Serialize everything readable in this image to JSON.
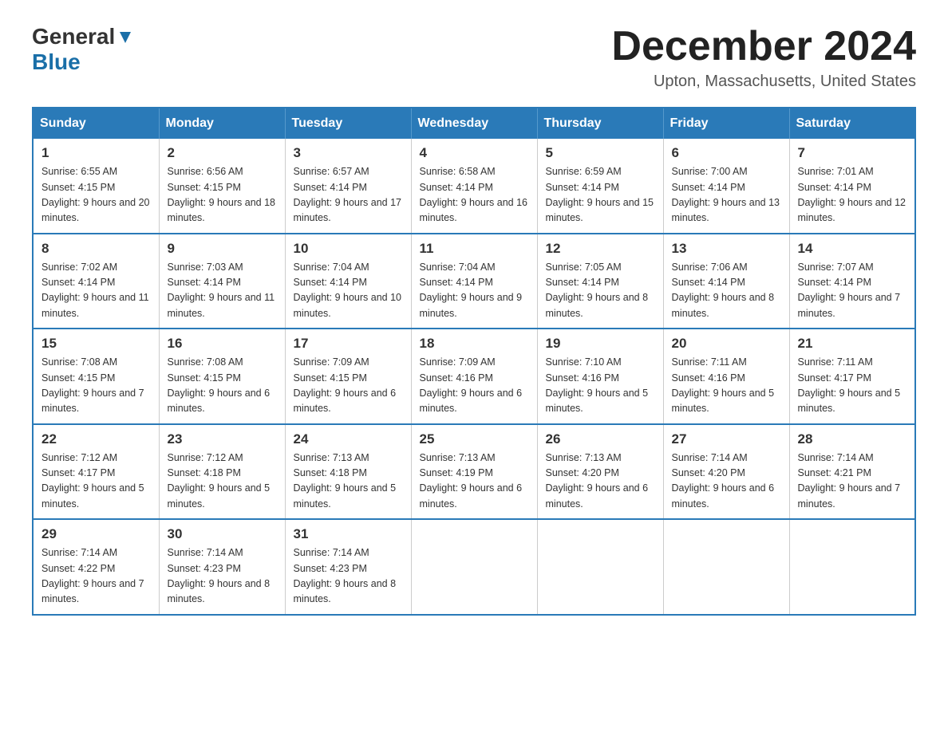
{
  "header": {
    "logo_general": "General",
    "logo_blue": "Blue",
    "month_title": "December 2024",
    "location": "Upton, Massachusetts, United States"
  },
  "days_of_week": [
    "Sunday",
    "Monday",
    "Tuesday",
    "Wednesday",
    "Thursday",
    "Friday",
    "Saturday"
  ],
  "weeks": [
    [
      {
        "day": "1",
        "sunrise": "Sunrise: 6:55 AM",
        "sunset": "Sunset: 4:15 PM",
        "daylight": "Daylight: 9 hours and 20 minutes."
      },
      {
        "day": "2",
        "sunrise": "Sunrise: 6:56 AM",
        "sunset": "Sunset: 4:15 PM",
        "daylight": "Daylight: 9 hours and 18 minutes."
      },
      {
        "day": "3",
        "sunrise": "Sunrise: 6:57 AM",
        "sunset": "Sunset: 4:14 PM",
        "daylight": "Daylight: 9 hours and 17 minutes."
      },
      {
        "day": "4",
        "sunrise": "Sunrise: 6:58 AM",
        "sunset": "Sunset: 4:14 PM",
        "daylight": "Daylight: 9 hours and 16 minutes."
      },
      {
        "day": "5",
        "sunrise": "Sunrise: 6:59 AM",
        "sunset": "Sunset: 4:14 PM",
        "daylight": "Daylight: 9 hours and 15 minutes."
      },
      {
        "day": "6",
        "sunrise": "Sunrise: 7:00 AM",
        "sunset": "Sunset: 4:14 PM",
        "daylight": "Daylight: 9 hours and 13 minutes."
      },
      {
        "day": "7",
        "sunrise": "Sunrise: 7:01 AM",
        "sunset": "Sunset: 4:14 PM",
        "daylight": "Daylight: 9 hours and 12 minutes."
      }
    ],
    [
      {
        "day": "8",
        "sunrise": "Sunrise: 7:02 AM",
        "sunset": "Sunset: 4:14 PM",
        "daylight": "Daylight: 9 hours and 11 minutes."
      },
      {
        "day": "9",
        "sunrise": "Sunrise: 7:03 AM",
        "sunset": "Sunset: 4:14 PM",
        "daylight": "Daylight: 9 hours and 11 minutes."
      },
      {
        "day": "10",
        "sunrise": "Sunrise: 7:04 AM",
        "sunset": "Sunset: 4:14 PM",
        "daylight": "Daylight: 9 hours and 10 minutes."
      },
      {
        "day": "11",
        "sunrise": "Sunrise: 7:04 AM",
        "sunset": "Sunset: 4:14 PM",
        "daylight": "Daylight: 9 hours and 9 minutes."
      },
      {
        "day": "12",
        "sunrise": "Sunrise: 7:05 AM",
        "sunset": "Sunset: 4:14 PM",
        "daylight": "Daylight: 9 hours and 8 minutes."
      },
      {
        "day": "13",
        "sunrise": "Sunrise: 7:06 AM",
        "sunset": "Sunset: 4:14 PM",
        "daylight": "Daylight: 9 hours and 8 minutes."
      },
      {
        "day": "14",
        "sunrise": "Sunrise: 7:07 AM",
        "sunset": "Sunset: 4:14 PM",
        "daylight": "Daylight: 9 hours and 7 minutes."
      }
    ],
    [
      {
        "day": "15",
        "sunrise": "Sunrise: 7:08 AM",
        "sunset": "Sunset: 4:15 PM",
        "daylight": "Daylight: 9 hours and 7 minutes."
      },
      {
        "day": "16",
        "sunrise": "Sunrise: 7:08 AM",
        "sunset": "Sunset: 4:15 PM",
        "daylight": "Daylight: 9 hours and 6 minutes."
      },
      {
        "day": "17",
        "sunrise": "Sunrise: 7:09 AM",
        "sunset": "Sunset: 4:15 PM",
        "daylight": "Daylight: 9 hours and 6 minutes."
      },
      {
        "day": "18",
        "sunrise": "Sunrise: 7:09 AM",
        "sunset": "Sunset: 4:16 PM",
        "daylight": "Daylight: 9 hours and 6 minutes."
      },
      {
        "day": "19",
        "sunrise": "Sunrise: 7:10 AM",
        "sunset": "Sunset: 4:16 PM",
        "daylight": "Daylight: 9 hours and 5 minutes."
      },
      {
        "day": "20",
        "sunrise": "Sunrise: 7:11 AM",
        "sunset": "Sunset: 4:16 PM",
        "daylight": "Daylight: 9 hours and 5 minutes."
      },
      {
        "day": "21",
        "sunrise": "Sunrise: 7:11 AM",
        "sunset": "Sunset: 4:17 PM",
        "daylight": "Daylight: 9 hours and 5 minutes."
      }
    ],
    [
      {
        "day": "22",
        "sunrise": "Sunrise: 7:12 AM",
        "sunset": "Sunset: 4:17 PM",
        "daylight": "Daylight: 9 hours and 5 minutes."
      },
      {
        "day": "23",
        "sunrise": "Sunrise: 7:12 AM",
        "sunset": "Sunset: 4:18 PM",
        "daylight": "Daylight: 9 hours and 5 minutes."
      },
      {
        "day": "24",
        "sunrise": "Sunrise: 7:13 AM",
        "sunset": "Sunset: 4:18 PM",
        "daylight": "Daylight: 9 hours and 5 minutes."
      },
      {
        "day": "25",
        "sunrise": "Sunrise: 7:13 AM",
        "sunset": "Sunset: 4:19 PM",
        "daylight": "Daylight: 9 hours and 6 minutes."
      },
      {
        "day": "26",
        "sunrise": "Sunrise: 7:13 AM",
        "sunset": "Sunset: 4:20 PM",
        "daylight": "Daylight: 9 hours and 6 minutes."
      },
      {
        "day": "27",
        "sunrise": "Sunrise: 7:14 AM",
        "sunset": "Sunset: 4:20 PM",
        "daylight": "Daylight: 9 hours and 6 minutes."
      },
      {
        "day": "28",
        "sunrise": "Sunrise: 7:14 AM",
        "sunset": "Sunset: 4:21 PM",
        "daylight": "Daylight: 9 hours and 7 minutes."
      }
    ],
    [
      {
        "day": "29",
        "sunrise": "Sunrise: 7:14 AM",
        "sunset": "Sunset: 4:22 PM",
        "daylight": "Daylight: 9 hours and 7 minutes."
      },
      {
        "day": "30",
        "sunrise": "Sunrise: 7:14 AM",
        "sunset": "Sunset: 4:23 PM",
        "daylight": "Daylight: 9 hours and 8 minutes."
      },
      {
        "day": "31",
        "sunrise": "Sunrise: 7:14 AM",
        "sunset": "Sunset: 4:23 PM",
        "daylight": "Daylight: 9 hours and 8 minutes."
      },
      null,
      null,
      null,
      null
    ]
  ]
}
